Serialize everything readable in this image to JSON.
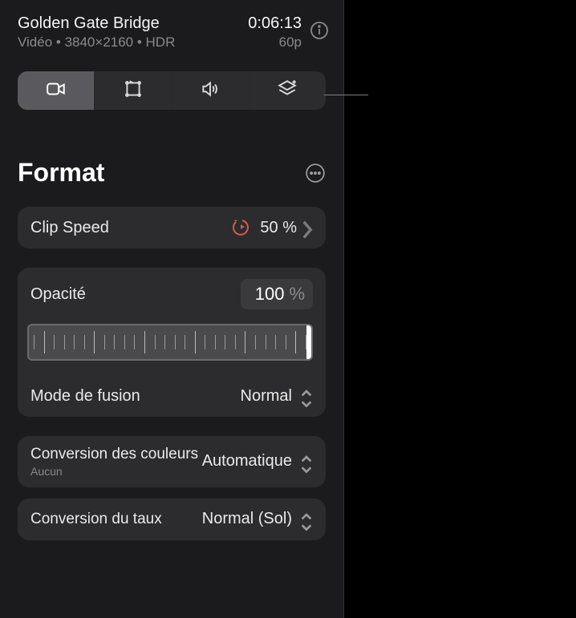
{
  "header": {
    "title": "Golden Gate Bridge",
    "subtitle": "Vidéo • 3840×2160 • HDR",
    "timecode": "0:06:13",
    "fps": "60p"
  },
  "section": {
    "title": "Format"
  },
  "clipSpeed": {
    "label": "Clip Speed",
    "value": "50 %"
  },
  "opacity": {
    "label": "Opacité",
    "value": "100",
    "unit": "%"
  },
  "blendMode": {
    "label": "Mode de fusion",
    "value": "Normal"
  },
  "colorConversion": {
    "label": "Conversion des couleurs",
    "sub": "Aucun",
    "value": "Automatique"
  },
  "rateConversion": {
    "label": "Conversion du taux",
    "value": "Normal (Sol)"
  }
}
